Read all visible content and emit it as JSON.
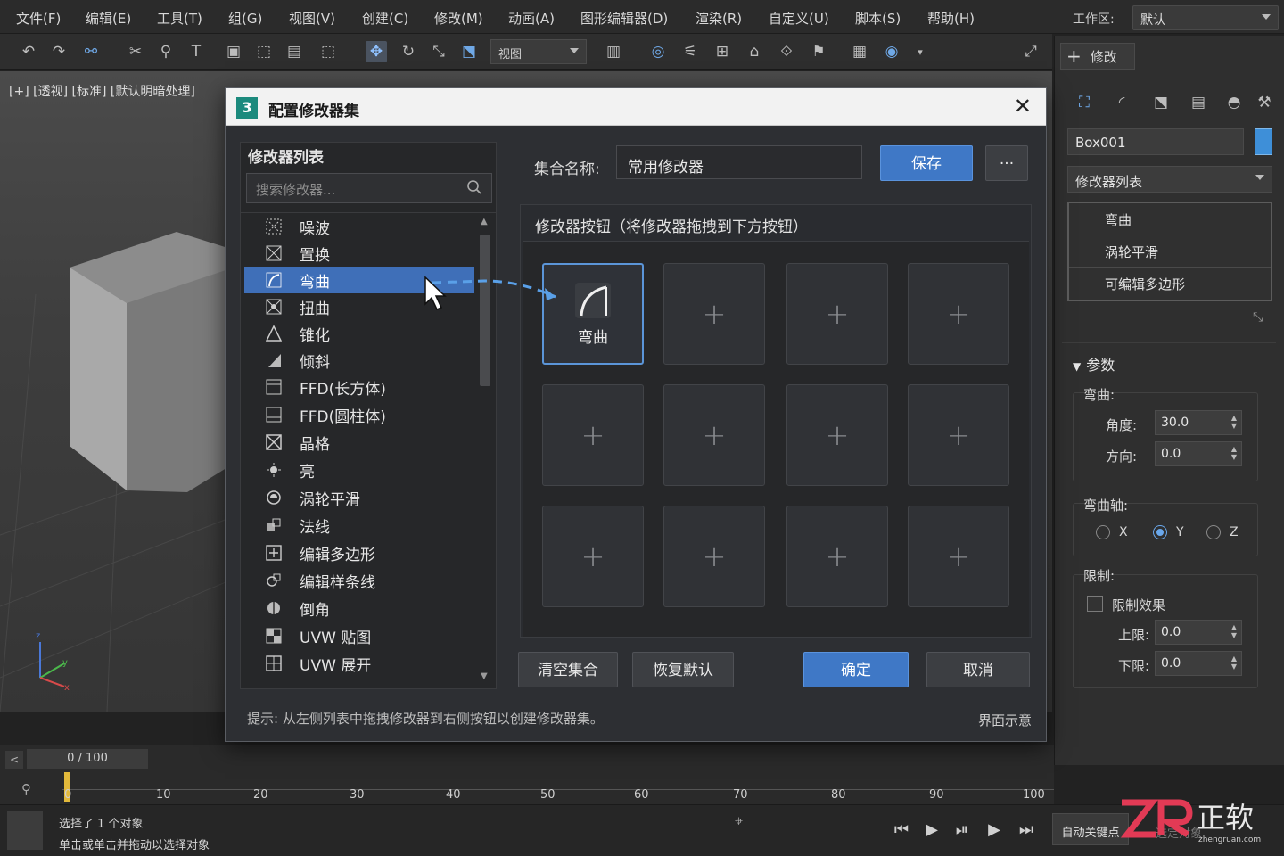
{
  "menu": {
    "items": [
      "文件(F)",
      "编辑(E)",
      "工具(T)",
      "组(G)",
      "视图(V)",
      "创建(C)",
      "修改(M)",
      "动画(A)",
      "图形编辑器(D)",
      "渲染(R)",
      "自定义(U)",
      "脚本(S)",
      "帮助(H)"
    ],
    "workspace_label": "工作区:",
    "workspace_value": "默认"
  },
  "toolbar": {
    "view_select": "视图"
  },
  "viewport": {
    "label": "[+] [透视] [标准] [默认明暗处理]",
    "axis_x": "x",
    "axis_y": "y",
    "axis_z": "z"
  },
  "right_panel": {
    "tab_label": "修改",
    "object_name": "Box001",
    "object_color": "#3e8fd8",
    "modifier_dropdown": "修改器列表",
    "stack": [
      "弯曲",
      "涡轮平滑",
      "可编辑多边形"
    ],
    "params_header": "参数",
    "bend_group": "弯曲:",
    "angle_label": "角度:",
    "angle_value": "30.0",
    "direction_label": "方向:",
    "direction_value": "0.0",
    "axis_group": "弯曲轴:",
    "axis_x": "X",
    "axis_y": "Y",
    "axis_z": "Z",
    "axis_selected": "Y",
    "limit_group": "限制:",
    "limit_effect": "限制效果",
    "upper_label": "上限:",
    "upper_value": "0.0",
    "lower_label": "下限:",
    "lower_value": "0.0"
  },
  "timeline": {
    "frame_display": "0 / 100",
    "ticks": [
      "0",
      "10",
      "20",
      "30",
      "40",
      "50",
      "60",
      "70",
      "80",
      "90",
      "100"
    ]
  },
  "status": {
    "line1": "选择了 1 个对象",
    "line2": "单击或单击并拖动以选择对象",
    "autokey": "自动关键点",
    "set_key_obj": "选定对象"
  },
  "dialog": {
    "badge": "3",
    "title": "配置修改器集",
    "list_header": "修改器列表",
    "search_placeholder": "搜索修改器...",
    "list_items": [
      {
        "label": "噪波",
        "icon": "noise-icon"
      },
      {
        "label": "置换",
        "icon": "displace-icon"
      },
      {
        "label": "弯曲",
        "icon": "bend-icon",
        "selected": true
      },
      {
        "label": "扭曲",
        "icon": "twist-icon"
      },
      {
        "label": "锥化",
        "icon": "taper-icon"
      },
      {
        "label": "倾斜",
        "icon": "skew-icon"
      },
      {
        "label": "FFD(长方体)",
        "icon": "ffd-box-icon"
      },
      {
        "label": "FFD(圆柱体)",
        "icon": "ffd-cyl-icon"
      },
      {
        "label": "晶格",
        "icon": "lattice-icon"
      },
      {
        "label": "亮",
        "icon": "shine-icon"
      },
      {
        "label": "涡轮平滑",
        "icon": "turbosmooth-icon"
      },
      {
        "label": "法线",
        "icon": "normal-icon"
      },
      {
        "label": "编辑多边形",
        "icon": "edit-poly-icon"
      },
      {
        "label": "编辑样条线",
        "icon": "edit-spline-icon"
      },
      {
        "label": "倒角",
        "icon": "bevel-icon"
      },
      {
        "label": "UVW 贴图",
        "icon": "uvw-map-icon"
      },
      {
        "label": "UVW 展开",
        "icon": "uvw-unwrap-icon"
      }
    ],
    "set_name_label": "集合名称:",
    "set_name_value": "常用修改器",
    "save_button": "保存",
    "more_button": "···",
    "buttons_header": "修改器按钮（将修改器拖拽到下方按钮）",
    "grid_first_label": "弯曲",
    "grid_plus": "+",
    "clear_button": "清空集合",
    "reset_button": "恢复默认",
    "ok_button": "确定",
    "cancel_button": "取消",
    "hint": "提示: 从左侧列表中拖拽修改器到右侧按钮以创建修改器集。",
    "hint_right": "界面示意"
  },
  "watermark": {
    "text": "正软",
    "url": "zhengruan.com"
  }
}
